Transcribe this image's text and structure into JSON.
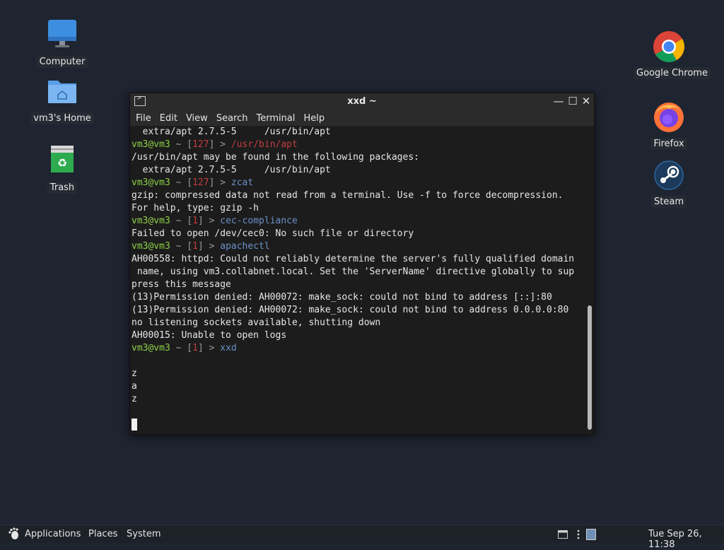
{
  "desktop": {
    "icons_left": [
      {
        "label": "Computer",
        "icon": "monitor-icon"
      },
      {
        "label": "vm3's Home",
        "icon": "home-folder-icon"
      },
      {
        "label": "Trash",
        "icon": "trash-icon"
      }
    ],
    "icons_right": [
      {
        "label": "Google Chrome",
        "icon": "chrome-icon"
      },
      {
        "label": "Firefox",
        "icon": "firefox-icon"
      },
      {
        "label": "Steam",
        "icon": "steam-icon"
      }
    ]
  },
  "window": {
    "title": "xxd ~",
    "menu": [
      "File",
      "Edit",
      "View",
      "Search",
      "Terminal",
      "Help"
    ],
    "controls": {
      "minimize": "—",
      "maximize": "☐",
      "close": "✕"
    }
  },
  "terminal": {
    "lines": [
      {
        "type": "out",
        "text": "  extra/apt 2.7.5-5     /usr/bin/apt"
      },
      {
        "type": "prompt",
        "user": "vm3@vm3",
        "tilde": "~",
        "code": "127",
        "cmd": "/usr/bin/apt",
        "cmd_err": true
      },
      {
        "type": "out",
        "text": "/usr/bin/apt may be found in the following packages:"
      },
      {
        "type": "out",
        "text": "  extra/apt 2.7.5-5     /usr/bin/apt"
      },
      {
        "type": "prompt",
        "user": "vm3@vm3",
        "tilde": "~",
        "code": "127",
        "cmd": "zcat",
        "cmd_err": false
      },
      {
        "type": "out",
        "text": "gzip: compressed data not read from a terminal. Use -f to force decompression."
      },
      {
        "type": "out",
        "text": "For help, type: gzip -h"
      },
      {
        "type": "prompt",
        "user": "vm3@vm3",
        "tilde": "~",
        "code": "1",
        "cmd": "cec-compliance",
        "cmd_err": false
      },
      {
        "type": "out",
        "text": "Failed to open /dev/cec0: No such file or directory"
      },
      {
        "type": "prompt",
        "user": "vm3@vm3",
        "tilde": "~",
        "code": "1",
        "cmd": "apachectl",
        "cmd_err": false
      },
      {
        "type": "out",
        "text": "AH00558: httpd: Could not reliably determine the server's fully qualified domain"
      },
      {
        "type": "out",
        "text": " name, using vm3.collabnet.local. Set the 'ServerName' directive globally to sup"
      },
      {
        "type": "out",
        "text": "press this message"
      },
      {
        "type": "out",
        "text": "(13)Permission denied: AH00072: make_sock: could not bind to address [::]:80"
      },
      {
        "type": "out",
        "text": "(13)Permission denied: AH00072: make_sock: could not bind to address 0.0.0.0:80"
      },
      {
        "type": "out",
        "text": "no listening sockets available, shutting down"
      },
      {
        "type": "out",
        "text": "AH00015: Unable to open logs"
      },
      {
        "type": "prompt",
        "user": "vm3@vm3",
        "tilde": "~",
        "code": "1",
        "cmd": "xxd",
        "cmd_err": false
      },
      {
        "type": "out",
        "text": ""
      },
      {
        "type": "out",
        "text": "z"
      },
      {
        "type": "out",
        "text": "a"
      },
      {
        "type": "out",
        "text": "z"
      },
      {
        "type": "out",
        "text": ""
      },
      {
        "type": "cursor",
        "text": ""
      }
    ],
    "prompt_sep": ">"
  },
  "panel": {
    "applications": "Applications",
    "places": "Places",
    "system": "System",
    "clock": "Tue Sep 26, 11:38"
  },
  "colors": {
    "desktop_bg": "#1e2430",
    "prompt_user": "#8ccf47",
    "prompt_code": "#c43d3d",
    "command": "#6a8fc7"
  }
}
